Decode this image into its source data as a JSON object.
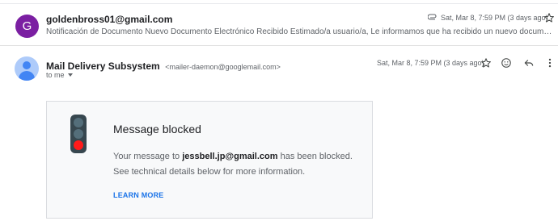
{
  "message_1": {
    "avatar_letter": "G",
    "sender": "goldenbross01@gmail.com",
    "snippet": "Notificación de Documento Nuevo Documento Electrónico Recibido Estimado/a usuario/a, Le informamos que ha recibido un nuevo documento electrónico. Envia...",
    "date": "Sat, Mar 8, 7:59 PM (3 days ago)",
    "avatar_color": "#7b1fa2"
  },
  "message_2": {
    "sender_name": "Mail Delivery Subsystem",
    "sender_email": "<mailer-daemon@googlemail.com>",
    "to_label": "to me",
    "date": "Sat, Mar 8, 7:59 PM (3 days ago)"
  },
  "bounce_card": {
    "title": "Message blocked",
    "body_prefix": "Your message to",
    "recipient": "jessbell.jp@gmail.com",
    "body_suffix": "has been blocked. See technical details below for more information.",
    "learn_more": "LEARN MORE",
    "link_color": "#1a73e8"
  },
  "icons": {
    "attachment": "paperclip-icon",
    "star": "star-icon",
    "emoji": "emoji-icon",
    "reply": "reply-icon",
    "more": "more-icon",
    "traffic_light": "traffic-light-icon"
  }
}
